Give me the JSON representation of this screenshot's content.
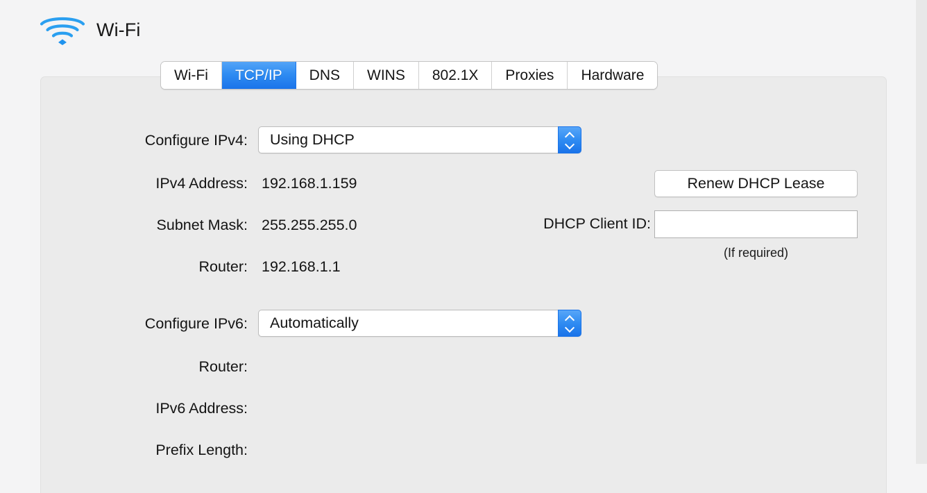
{
  "header": {
    "title": "Wi-Fi",
    "icon": "wifi-icon"
  },
  "tabs": [
    {
      "label": "Wi-Fi",
      "selected": false
    },
    {
      "label": "TCP/IP",
      "selected": true
    },
    {
      "label": "DNS",
      "selected": false
    },
    {
      "label": "WINS",
      "selected": false
    },
    {
      "label": "802.1X",
      "selected": false
    },
    {
      "label": "Proxies",
      "selected": false
    },
    {
      "label": "Hardware",
      "selected": false
    }
  ],
  "ipv4": {
    "configure_label": "Configure IPv4:",
    "configure_value": "Using DHCP",
    "address_label": "IPv4 Address:",
    "address_value": "192.168.1.159",
    "subnet_label": "Subnet Mask:",
    "subnet_value": "255.255.255.0",
    "router_label": "Router:",
    "router_value": "192.168.1.1"
  },
  "dhcp": {
    "renew_button": "Renew DHCP Lease",
    "client_id_label": "DHCP Client ID:",
    "client_id_value": "",
    "client_id_placeholder": "",
    "hint": "(If required)"
  },
  "ipv6": {
    "configure_label": "Configure IPv6:",
    "configure_value": "Automatically",
    "router_label": "Router:",
    "router_value": "",
    "address_label": "IPv6 Address:",
    "address_value": "",
    "prefix_label": "Prefix Length:",
    "prefix_value": ""
  },
  "colors": {
    "accent_blue": "#2f8cf2",
    "wifi_icon_blue": "#2a9ff0",
    "panel_bg": "#ebebeb",
    "page_bg": "#f4f4f5"
  }
}
